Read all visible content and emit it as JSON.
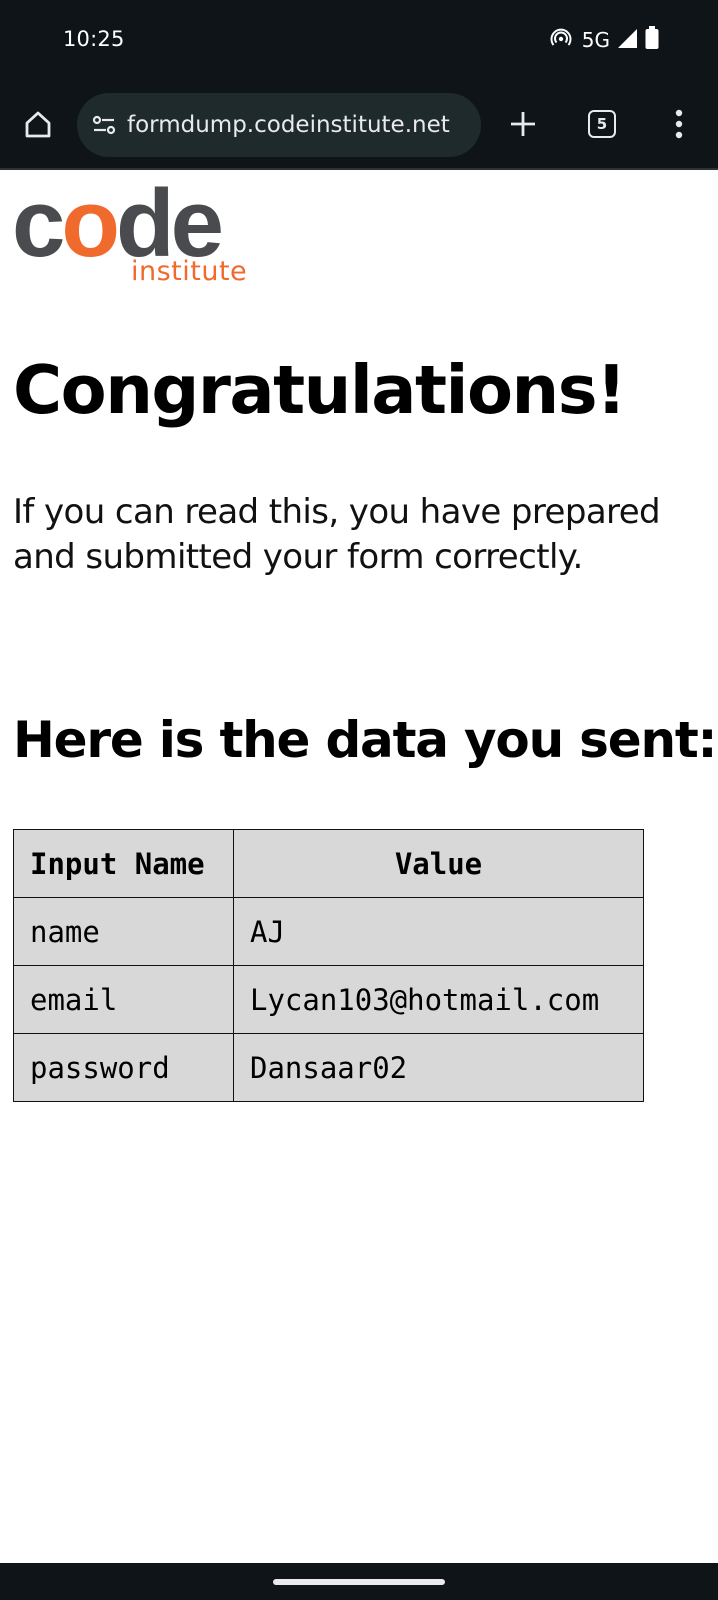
{
  "status_bar": {
    "time": "10:25",
    "network": "5G",
    "icons": [
      "hotspot-icon",
      "signal-icon",
      "battery-icon"
    ]
  },
  "browser": {
    "url": "formdump.codeinstitute.net",
    "tab_count": "5",
    "icons": [
      "home-icon",
      "site-settings-icon",
      "plus-icon",
      "tabs-icon",
      "more-vert-icon"
    ]
  },
  "logo": {
    "word_prefix": "c",
    "word_o": "o",
    "word_suffix": "de",
    "sub": "institute",
    "brand_colors": {
      "gray": "#4a4b4e",
      "orange": "#f06a2d"
    }
  },
  "page": {
    "title": "Congratulations!",
    "intro": "If you can read this, you have prepared and submitted your form correctly.",
    "subtitle": "Here is the data you sent:"
  },
  "table": {
    "headers": [
      "Input Name",
      "Value"
    ],
    "rows": [
      [
        "name",
        "AJ"
      ],
      [
        "email",
        "Lycan103@hotmail.com"
      ],
      [
        "password",
        "Dansaar02"
      ]
    ]
  }
}
